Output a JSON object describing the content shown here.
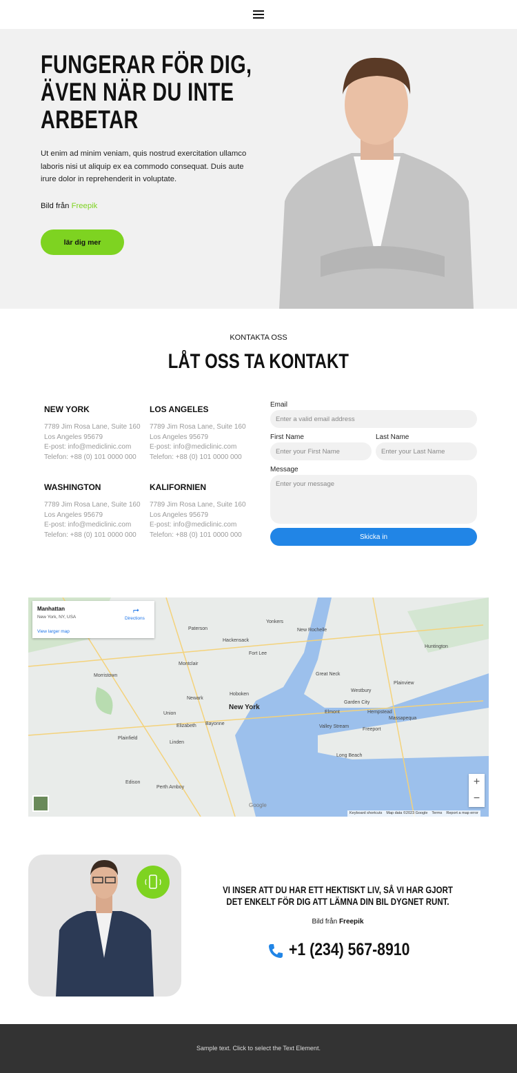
{
  "header": {
    "menu_icon": "hamburger-icon"
  },
  "hero": {
    "title": "FUNGERAR FÖR DIG, ÄVEN NÄR DU INTE ARBETAR",
    "text": "Ut enim ad minim veniam, quis nostrud exercitation ullamco laboris nisi ut aliquip ex ea commodo consequat. Duis aute irure dolor in reprehenderit in voluptate.",
    "credit_prefix": "Bild från",
    "credit_link": "Freepik",
    "cta": "lär dig mer"
  },
  "contact": {
    "kicker": "KONTAKTA OSS",
    "title": "LÅT OSS TA KONTAKT",
    "offices": [
      {
        "name": "NEW YORK",
        "address": "7789 Jim Rosa Lane, Suite 160",
        "city": "Los Angeles 95679",
        "email": "E-post: info@mediclinic.com",
        "phone": "Telefon: +88 (0) 101 0000 000"
      },
      {
        "name": "LOS ANGELES",
        "address": "7789 Jim Rosa Lane, Suite 160",
        "city": "Los Angeles 95679",
        "email": "E-post: info@mediclinic.com",
        "phone": "Telefon: +88 (0) 101 0000 000"
      },
      {
        "name": "WASHINGTON",
        "address": "7789 Jim Rosa Lane, Suite 160",
        "city": "Los Angeles 95679",
        "email": "E-post: info@mediclinic.com",
        "phone": "Telefon: +88 (0) 101 0000 000"
      },
      {
        "name": "KALIFORNIEN",
        "address": "7789 Jim Rosa Lane, Suite 160",
        "city": "Los Angeles 95679",
        "email": "E-post: info@mediclinic.com",
        "phone": "Telefon: +88 (0) 101 0000 000"
      }
    ],
    "form": {
      "email_label": "Email",
      "email_placeholder": "Enter a valid email address",
      "first_label": "First Name",
      "first_placeholder": "Enter your First Name",
      "last_label": "Last Name",
      "last_placeholder": "Enter your Last Name",
      "message_label": "Message",
      "message_placeholder": "Enter your message",
      "submit": "Skicka in"
    }
  },
  "map": {
    "place": "Manhattan",
    "place_sub": "New York, NY, USA",
    "directions": "Directions",
    "larger": "View larger map",
    "labels": [
      "Yonkers",
      "New Rochelle",
      "Paterson",
      "Hackensack",
      "Fort Lee",
      "Newark",
      "New York",
      "Hoboken",
      "Elizabeth",
      "Bayonne",
      "Linden",
      "Union",
      "Montclair",
      "Garden City",
      "Hempstead",
      "Freeport",
      "Long Beach",
      "Huntington",
      "Plainview",
      "Massapequa",
      "Westbury",
      "Edison",
      "Perth Amboy",
      "Morristown",
      "Plainfield",
      "Great Neck",
      "Elmont",
      "Valley Stream"
    ],
    "google": "Google",
    "attribution": [
      "Keyboard shortcuts",
      "Map data ©2023 Google",
      "Terms",
      "Report a map error"
    ],
    "zoom_in": "+",
    "zoom_out": "−"
  },
  "promo": {
    "tagline": "VI INSER ATT DU HAR ETT HEKTISKT LIV, SÅ VI HAR GJORT DET ENKELT FÖR DIG ATT LÄMNA DIN BIL DYGNET RUNT.",
    "credit_prefix": "Bild från",
    "credit_link": "Freepik",
    "phone": "+1 (234) 567-8910"
  },
  "footer": {
    "text": "Sample text. Click to select the Text Element."
  },
  "colors": {
    "accent": "#7ed321",
    "button_blue": "#2185e6",
    "footer": "#333333",
    "hero_bg": "#f1f1f1"
  }
}
